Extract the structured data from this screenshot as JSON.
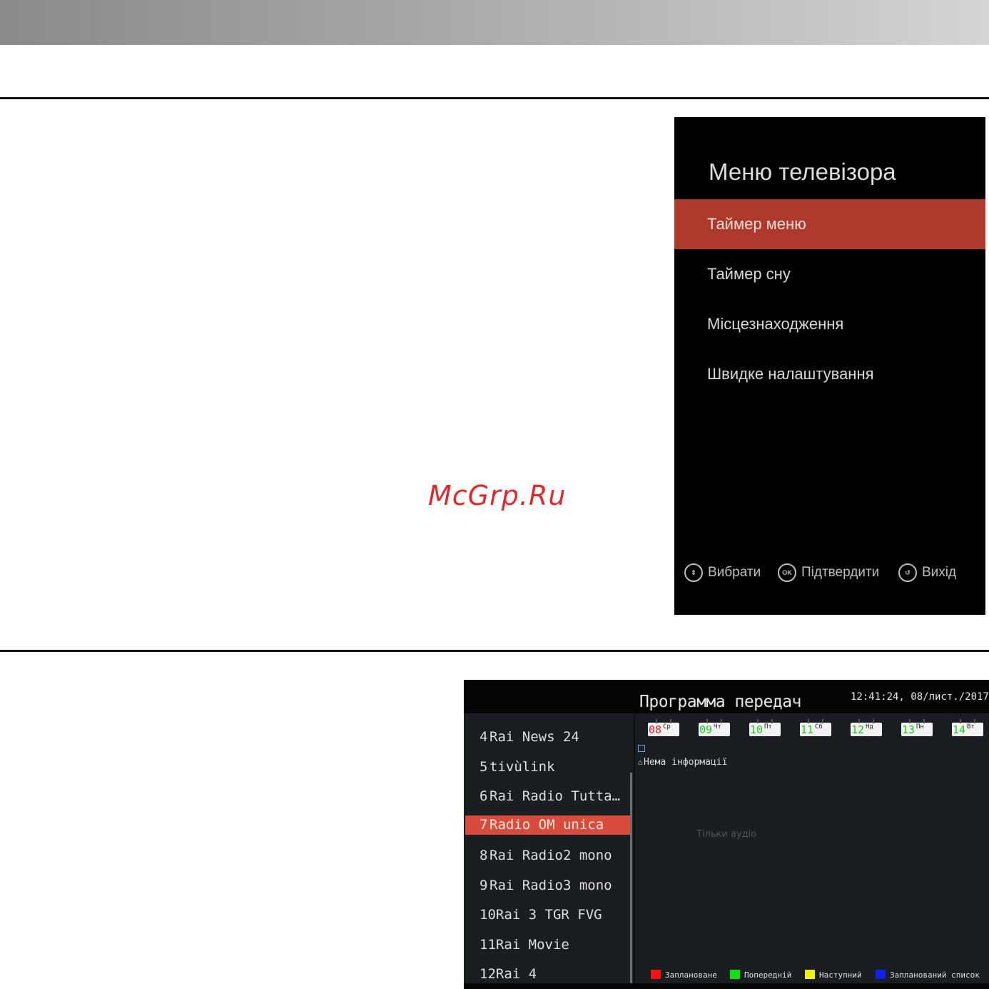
{
  "watermark": "McGrp.Ru",
  "tv_menu": {
    "title": "Меню телевізора",
    "items": [
      {
        "label": "Таймер меню",
        "selected": true
      },
      {
        "label": "Таймер сну",
        "selected": false
      },
      {
        "label": "Місцезнаходження",
        "selected": false
      },
      {
        "label": "Швидке налаштування",
        "selected": false
      }
    ],
    "footer": {
      "select_icon": "up-down-arrows-icon",
      "select_label": "Вибрати",
      "ok_icon_text": "OK",
      "ok_label": "Підтвердити",
      "exit_icon": "return-arrow-icon",
      "exit_label": "Вихід"
    },
    "accent_color": "#ad3a2d"
  },
  "epg": {
    "title": "Программа передач",
    "clock": "12:41:24, 08/лист./2017",
    "channels": [
      {
        "num": "4",
        "name": "Rai News 24"
      },
      {
        "num": "5",
        "name": "tivùlink"
      },
      {
        "num": "6",
        "name": "Rai Radio Tutta…"
      },
      {
        "num": "7",
        "name": "Radio OM unica"
      },
      {
        "num": "8",
        "name": "Rai Radio2 mono"
      },
      {
        "num": "9",
        "name": "Rai Radio3 mono"
      },
      {
        "num": "10",
        "name": "Rai 3 TGR FVG"
      },
      {
        "num": "11",
        "name": "Rai Movie"
      },
      {
        "num": "12",
        "name": "Rai 4"
      }
    ],
    "selected_channel": "7",
    "days": [
      {
        "num": "08",
        "dow": "Ср",
        "color": "#e02020"
      },
      {
        "num": "09",
        "dow": "Чт",
        "color": "#1fc81f"
      },
      {
        "num": "10",
        "dow": "Пт",
        "color": "#1fc81f"
      },
      {
        "num": "11",
        "dow": "Сб",
        "color": "#1fc81f"
      },
      {
        "num": "12",
        "dow": "Нд",
        "color": "#1fc81f"
      },
      {
        "num": "13",
        "dow": "Пн",
        "color": "#1fc81f"
      },
      {
        "num": "14",
        "dow": "Вт",
        "color": "#1fc81f"
      }
    ],
    "no_info": "Нема інформації",
    "audio_only": "Тільки аудіо",
    "legend": [
      {
        "label": "Заплановане",
        "color": "#ff1010"
      },
      {
        "label": "Попередній",
        "color": "#10e010"
      },
      {
        "label": "Наступний",
        "color": "#f0f010"
      },
      {
        "label": "Запланований список",
        "color": "#1020f0"
      }
    ],
    "selected_color": "#d94b3a"
  }
}
